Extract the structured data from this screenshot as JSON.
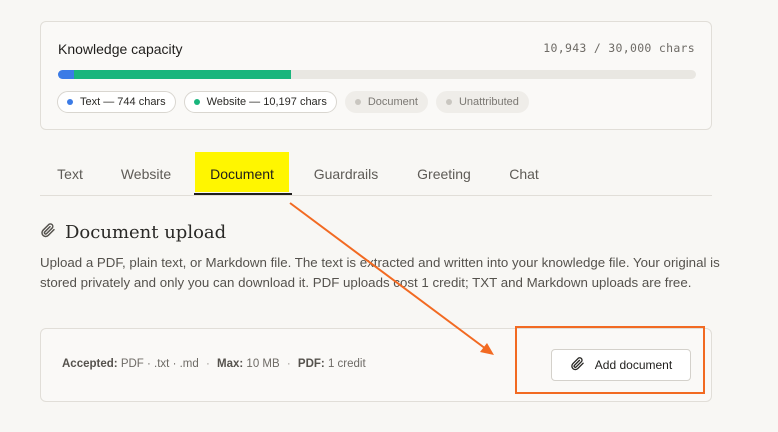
{
  "capacity": {
    "title": "Knowledge capacity",
    "count_label": "10,943 / 30,000 chars",
    "used": 10943,
    "total": 30000,
    "segments": [
      {
        "name": "text",
        "chars": 744,
        "color": "#3b7be6"
      },
      {
        "name": "website",
        "chars": 10197,
        "color": "#19b57c"
      }
    ],
    "chips": [
      {
        "label": "Text — 744 chars",
        "color": "#3b7be6",
        "active": true
      },
      {
        "label": "Website — 10,197 chars",
        "color": "#19b57c",
        "active": true
      },
      {
        "label": "Document",
        "color": "#c9c6c0",
        "active": false
      },
      {
        "label": "Unattributed",
        "color": "#c9c6c0",
        "active": false
      }
    ]
  },
  "tabs": [
    {
      "label": "Text"
    },
    {
      "label": "Website"
    },
    {
      "label": "Document",
      "selected": true
    },
    {
      "label": "Guardrails"
    },
    {
      "label": "Greeting"
    },
    {
      "label": "Chat"
    }
  ],
  "document": {
    "title": "Document upload",
    "description": "Upload a PDF, plain text, or Markdown file. The text is extracted and written into your knowledge file. Your original is stored privately and only you can download it. PDF uploads cost 1 credit; TXT and Markdown uploads are free.",
    "accepted_label": "Accepted:",
    "accepted_value": "PDF · .txt · .md",
    "max_label": "Max:",
    "max_value": "10 MB",
    "pdf_label": "PDF:",
    "pdf_value": "1 credit",
    "separator": "·",
    "add_button": "Add document"
  },
  "colors": {
    "annotation": "#f26a22",
    "tab_highlight": "#fff600"
  },
  "icons": {
    "section": "paperclip-icon",
    "button": "paperclip-icon"
  }
}
